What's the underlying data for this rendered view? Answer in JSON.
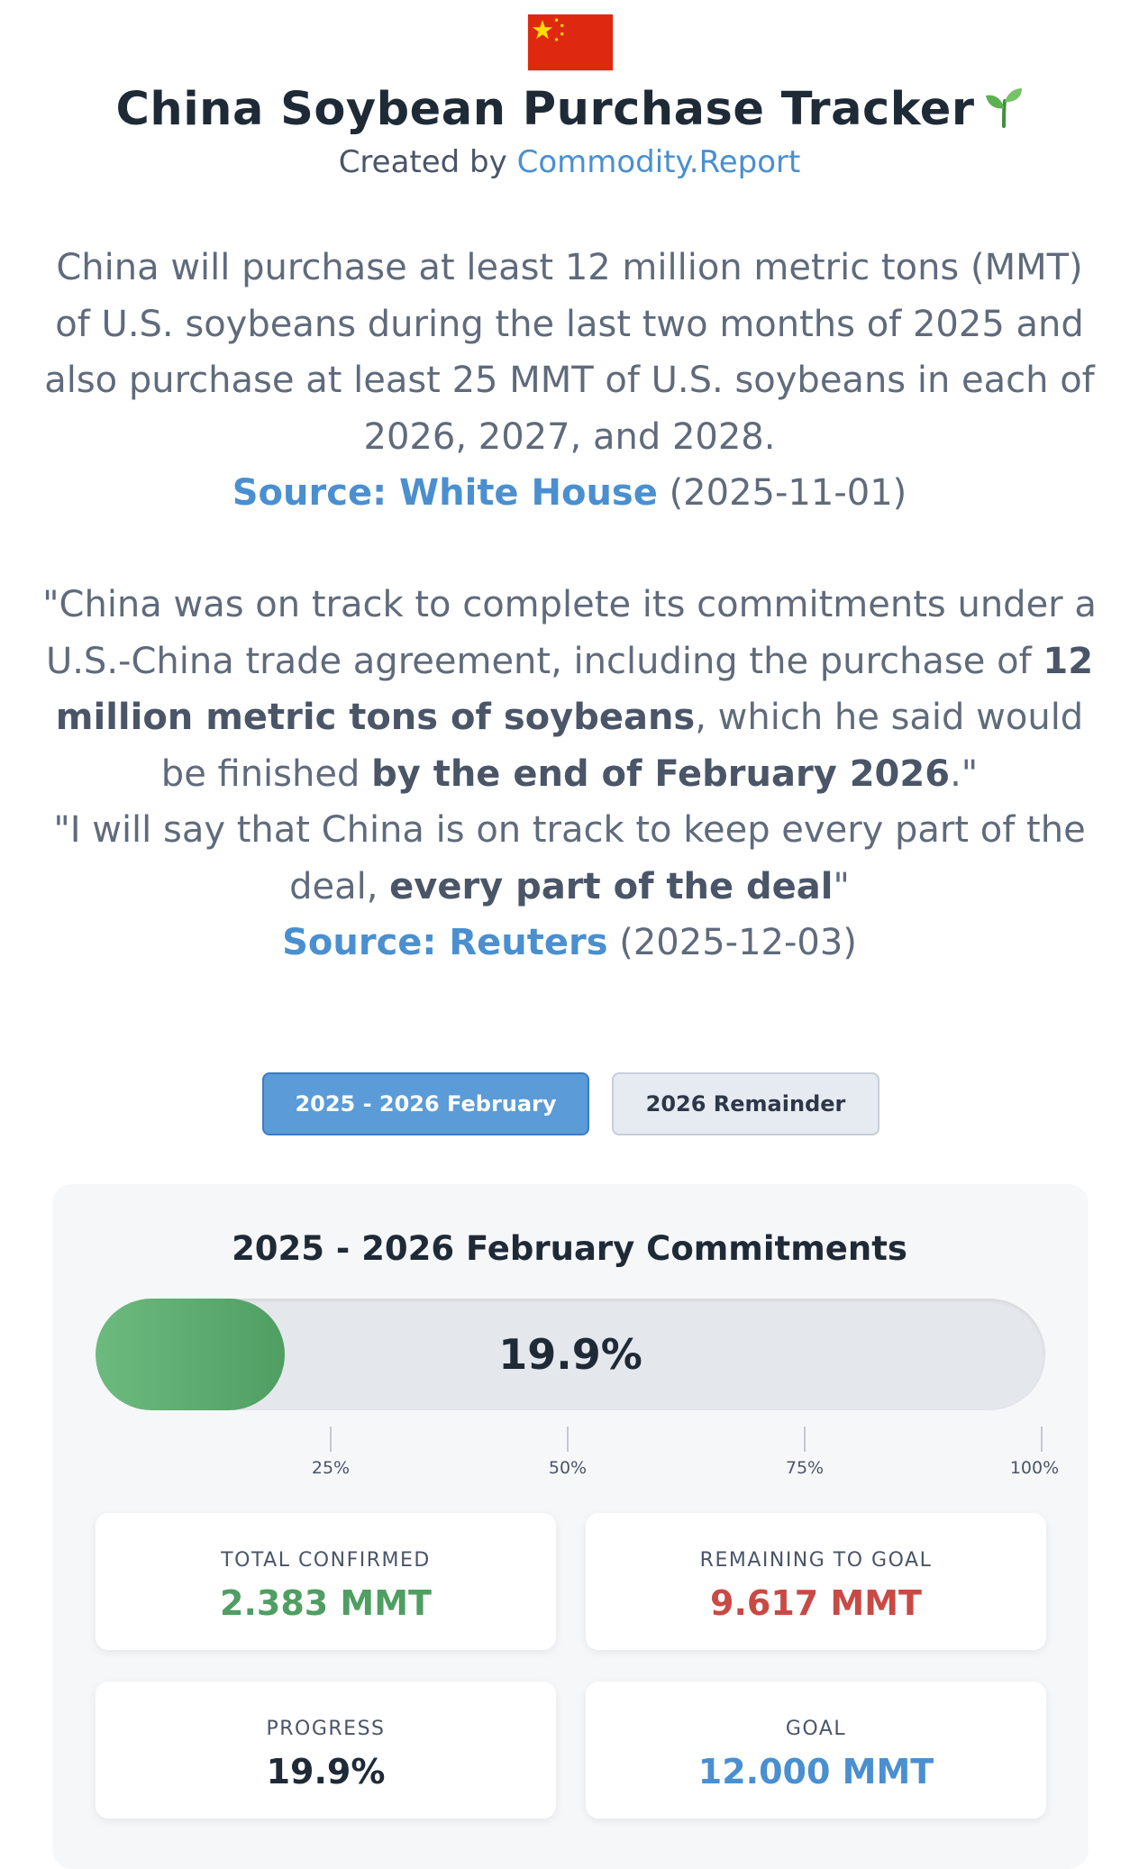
{
  "header": {
    "title": "China Soybean Purchase Tracker",
    "byline_prefix": "Created by",
    "byline_link": "Commodity.Report"
  },
  "quote1": {
    "text": "China will purchase at least 12 million metric tons (MMT) of U.S. soybeans during the last two months of 2025 and also purchase at least 25 MMT of U.S. soybeans in each of 2026, 2027, and 2028.",
    "source_label": "Source: White House",
    "date": "(2025-11-01)"
  },
  "quote2": {
    "part1": "\"China was on track to complete its commitments under a U.S.-China trade agreement, including the purchase of ",
    "bold1": "12 million metric tons of soybeans",
    "part2": ", which he said would be finished ",
    "bold2": "by the end of February 2026",
    "part3": ".\"",
    "part4": "\"I will say that China is on track to keep every part of the deal, ",
    "bold3": "every part of the deal",
    "part5": "\"",
    "source_label": "Source: Reuters",
    "date": "(2025-12-03)"
  },
  "tabs": [
    {
      "label": "2025 - 2026 February",
      "active": true
    },
    {
      "label": "2026 Remainder",
      "active": false
    }
  ],
  "panel": {
    "title": "2025 - 2026 February Commitments",
    "progress_fraction": 0.199,
    "progress_label": "19.9%",
    "ticks": [
      "25%",
      "50%",
      "75%",
      "100%"
    ]
  },
  "stats": [
    {
      "label": "TOTAL CONFIRMED",
      "value": "2.383 MMT",
      "color": "#4f9e62"
    },
    {
      "label": "REMAINING TO GOAL",
      "value": "9.617 MMT",
      "color": "#c94a45"
    },
    {
      "label": "PROGRESS",
      "value": "19.9%",
      "color": "#1f2a37"
    },
    {
      "label": "GOAL",
      "value": "12.000 MMT",
      "color": "#4a8fd0"
    }
  ],
  "icons": {
    "flag": "china-flag-icon",
    "title_emoji": "seedling-icon"
  }
}
